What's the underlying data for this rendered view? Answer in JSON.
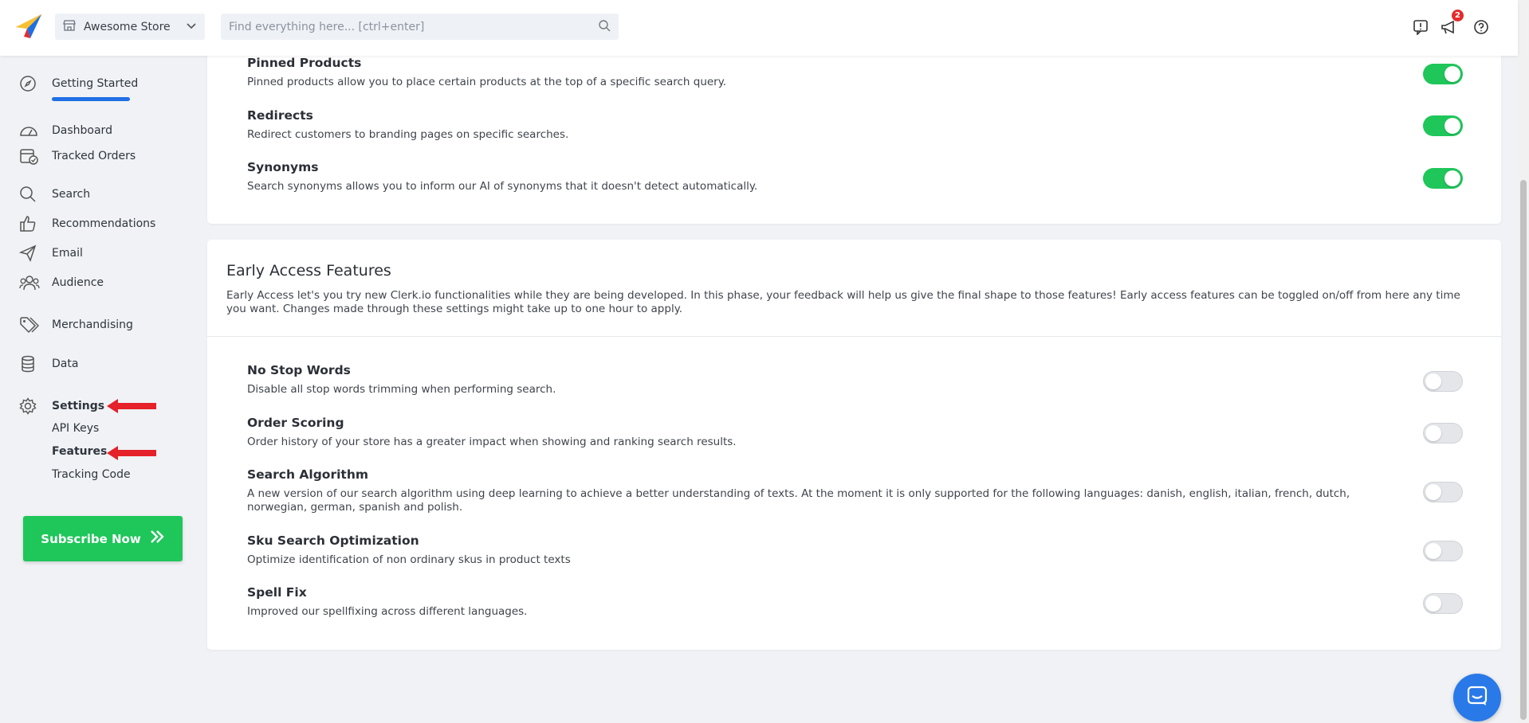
{
  "header": {
    "store_name": "Awesome Store",
    "search_placeholder": "Find everything here... [ctrl+enter]",
    "notification_count": "2"
  },
  "sidebar": {
    "getting_started": "Getting Started",
    "items": [
      {
        "label": "Dashboard",
        "icon": "gauge-icon"
      },
      {
        "label": "Tracked Orders",
        "icon": "calendar-check-icon"
      },
      {
        "label": "Search",
        "icon": "search-icon"
      },
      {
        "label": "Recommendations",
        "icon": "thumbs-up-icon"
      },
      {
        "label": "Email",
        "icon": "paper-plane-icon"
      },
      {
        "label": "Audience",
        "icon": "users-icon"
      },
      {
        "label": "Merchandising",
        "icon": "tags-icon"
      },
      {
        "label": "Data",
        "icon": "database-icon"
      },
      {
        "label": "Settings",
        "icon": "gear-icon"
      }
    ],
    "sub_items": [
      "API Keys",
      "Features",
      "Tracking Code"
    ],
    "subscribe_label": "Subscribe Now",
    "accent_color": "#1fc65a"
  },
  "search_features": [
    {
      "name": "Pinned Products",
      "desc": "Pinned products allow you to place certain products at the top of a specific search query.",
      "enabled": true
    },
    {
      "name": "Redirects",
      "desc": "Redirect customers to branding pages on specific searches.",
      "enabled": true
    },
    {
      "name": "Synonyms",
      "desc": "Search synonyms allows you to inform our AI of synonyms that it doesn't detect automatically.",
      "enabled": true
    }
  ],
  "early_access": {
    "title": "Early Access Features",
    "description": "Early Access let's you try new Clerk.io functionalities while they are being developed. In this phase, your feedback will help us give the final shape to those features! Early access features can be toggled on/off from here any time you want. Changes made through these settings might take up to one hour to apply.",
    "features": [
      {
        "name": "No Stop Words",
        "desc": "Disable all stop words trimming when performing search.",
        "enabled": false
      },
      {
        "name": "Order Scoring",
        "desc": "Order history of your store has a greater impact when showing and ranking search results.",
        "enabled": false
      },
      {
        "name": "Search Algorithm",
        "desc": "A new version of our search algorithm using deep learning to achieve a better understanding of texts. At the moment it is only supported for the following languages: danish, english, italian, french, dutch, norwegian, german, spanish and polish.",
        "enabled": false
      },
      {
        "name": "Sku Search Optimization",
        "desc": "Optimize identification of non ordinary skus in product texts",
        "enabled": false
      },
      {
        "name": "Spell Fix",
        "desc": "Improved our spellfixing across different languages.",
        "enabled": false
      }
    ]
  }
}
